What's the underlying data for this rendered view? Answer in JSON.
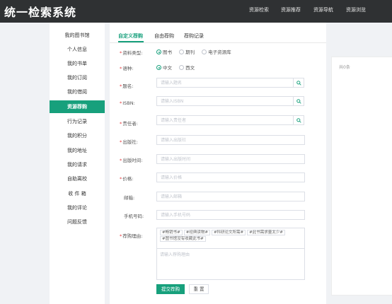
{
  "app": {
    "title": "统一检索系统"
  },
  "topnav": {
    "items": [
      {
        "label": "资源检索"
      },
      {
        "label": "资源推荐"
      },
      {
        "label": "资源导航"
      },
      {
        "label": "资源浏览"
      }
    ]
  },
  "sidebar": {
    "items": [
      {
        "label": "我的图书馆"
      },
      {
        "label": "个人信息"
      },
      {
        "label": "我的书单"
      },
      {
        "label": "我的订阅"
      },
      {
        "label": "我的借阅"
      },
      {
        "label": "资源荐购",
        "active": true
      },
      {
        "label": "行为记录"
      },
      {
        "label": "我的积分"
      },
      {
        "label": "我的地址"
      },
      {
        "label": "我的请求"
      },
      {
        "label": "自助离校"
      },
      {
        "label": "收 件 箱"
      },
      {
        "label": "我的评论"
      },
      {
        "label": "问题反馈"
      }
    ]
  },
  "tabs": {
    "items": [
      {
        "label": "自定义荐购",
        "active": true
      },
      {
        "label": "自由荐购"
      },
      {
        "label": "荐购记录"
      }
    ]
  },
  "form": {
    "resource_type": {
      "label": "资料类型:",
      "options": [
        "图书",
        "期刊",
        "电子资源库"
      ],
      "selected": "图书"
    },
    "language": {
      "label": "语种:",
      "options": [
        "中文",
        "西文"
      ],
      "selected": "中文"
    },
    "title": {
      "label": "题名:",
      "placeholder": "请输入题名"
    },
    "isbn": {
      "label": "ISBN:",
      "placeholder": "请输入ISBN"
    },
    "author": {
      "label": "责任者:",
      "placeholder": "请输入责任者"
    },
    "publisher": {
      "label": "出版社:",
      "placeholder": "请输入出版社"
    },
    "pub_date": {
      "label": "出版时间:",
      "placeholder": "请输入出版时间"
    },
    "price": {
      "label": "价格:",
      "placeholder": "请输入价格"
    },
    "email": {
      "label": "邮箱:",
      "placeholder": "请输入邮箱"
    },
    "phone": {
      "label": "手机号码:",
      "placeholder": "请输入手机号码"
    },
    "reason": {
      "label": "荐购理由:",
      "tags": [
        "#畅销书#",
        "#经典读物#",
        "#科研论文所需#",
        "#此书需求量太少#",
        "#图书馆没有收藏此书#"
      ],
      "placeholder": "请输入荐购理由"
    },
    "submit_label": "提交荐购",
    "reset_label": "重 置"
  },
  "records": {
    "count_text": "共0条"
  },
  "colors": {
    "accent": "#17a07c",
    "topbar": "#2f3133",
    "required": "#e4393c"
  },
  "icons": {
    "search": "search-icon"
  }
}
